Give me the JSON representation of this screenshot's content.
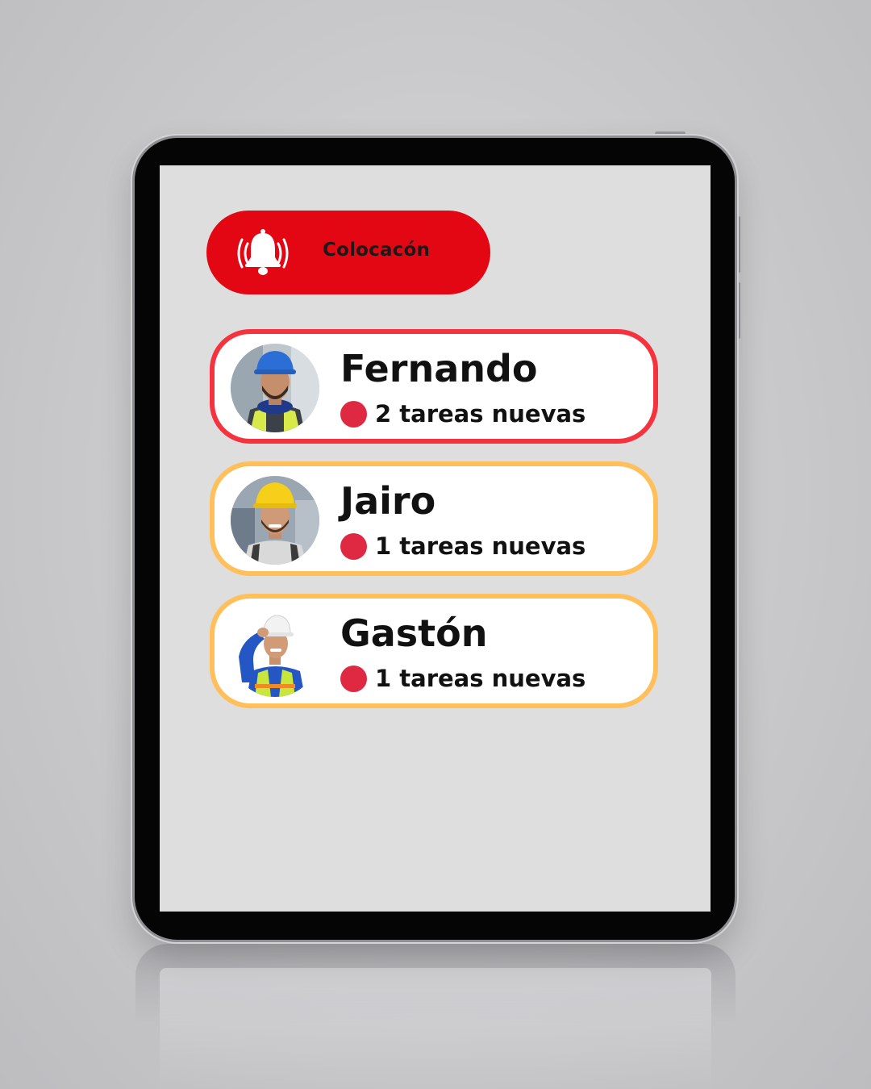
{
  "header": {
    "alert_label": "Colocacón",
    "icon": "bell-ringing-icon",
    "accent_color": "#e30613"
  },
  "workers": [
    {
      "name": "Fernando",
      "tasks": "2 tareas nuevas",
      "status": "urgent",
      "border_color": "#f5333f",
      "avatar": "worker-blue-helmet-avatar"
    },
    {
      "name": "Jairo",
      "tasks": "1 tareas nuevas",
      "status": "normal",
      "border_color": "#ffbf5a",
      "avatar": "worker-yellow-helmet-avatar"
    },
    {
      "name": "Gastón",
      "tasks": "1 tareas nuevas",
      "status": "normal",
      "border_color": "#ffbf5a",
      "avatar": "worker-white-helmet-avatar"
    }
  ],
  "status_dot_color": "#df2841"
}
